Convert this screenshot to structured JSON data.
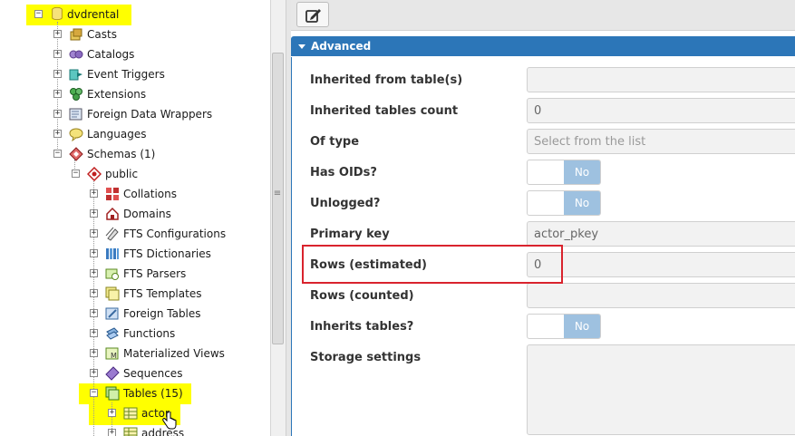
{
  "tree": {
    "database": "dvdrental",
    "items": [
      {
        "key": "casts",
        "label": "Casts"
      },
      {
        "key": "catalogs",
        "label": "Catalogs"
      },
      {
        "key": "event-triggers",
        "label": "Event Triggers"
      },
      {
        "key": "extensions",
        "label": "Extensions"
      },
      {
        "key": "foreign-data-wrappers",
        "label": "Foreign Data Wrappers"
      },
      {
        "key": "languages",
        "label": "Languages"
      },
      {
        "key": "schemas",
        "label": "Schemas (1)"
      }
    ],
    "schema": "public",
    "schema_items": [
      {
        "key": "collations",
        "label": "Collations"
      },
      {
        "key": "domains",
        "label": "Domains"
      },
      {
        "key": "fts-configurations",
        "label": "FTS Configurations"
      },
      {
        "key": "fts-dictionaries",
        "label": "FTS Dictionaries"
      },
      {
        "key": "fts-parsers",
        "label": "FTS Parsers"
      },
      {
        "key": "fts-templates",
        "label": "FTS Templates"
      },
      {
        "key": "foreign-tables",
        "label": "Foreign Tables"
      },
      {
        "key": "functions",
        "label": "Functions"
      },
      {
        "key": "materialized-views",
        "label": "Materialized Views"
      },
      {
        "key": "sequences",
        "label": "Sequences"
      }
    ],
    "tables": "Tables (15)",
    "table_items": [
      {
        "key": "actor",
        "label": "actor"
      },
      {
        "key": "address",
        "label": "address"
      }
    ],
    "highlight_color": "#ffff00"
  },
  "panel": {
    "section_title": "Advanced",
    "accent_color": "#2c76b8",
    "fields": [
      {
        "key": "inherited-from",
        "label": "Inherited from table(s)",
        "kind": "input",
        "value": ""
      },
      {
        "key": "inherited-count",
        "label": "Inherited tables count",
        "kind": "input",
        "value": "0"
      },
      {
        "key": "of-type",
        "label": "Of type",
        "kind": "select",
        "placeholder": "Select from the list"
      },
      {
        "key": "has-oids",
        "label": "Has OIDs?",
        "kind": "toggle",
        "value": "No"
      },
      {
        "key": "unlogged",
        "label": "Unlogged?",
        "kind": "toggle",
        "value": "No"
      },
      {
        "key": "primary-key",
        "label": "Primary key",
        "kind": "input",
        "value": "actor_pkey"
      },
      {
        "key": "rows-estimated",
        "label": "Rows (estimated)",
        "kind": "input",
        "value": "0"
      },
      {
        "key": "rows-counted",
        "label": "Rows (counted)",
        "kind": "input",
        "value": ""
      },
      {
        "key": "inherits-tables",
        "label": "Inherits tables?",
        "kind": "toggle",
        "value": "No"
      },
      {
        "key": "storage-settings",
        "label": "Storage settings",
        "kind": "textarea",
        "value": ""
      }
    ],
    "annotation_color": "#d9232d"
  },
  "icons": {
    "edit": "edit-icon",
    "database": "database-icon",
    "cursor": "hand-cursor-icon"
  }
}
